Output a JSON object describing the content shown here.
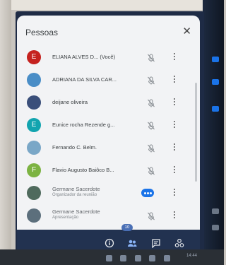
{
  "panel": {
    "title": "Pessoas",
    "close_icon": "close-icon"
  },
  "participants": [
    {
      "initial": "E",
      "avatar_color": "#c5221f",
      "name": "ELIANA ALVES D...  (Você)",
      "subtitle": "",
      "mic": "muted"
    },
    {
      "initial": "",
      "avatar_color": "#4a8ec7",
      "name": "ADRIANA DA SILVA CAR...",
      "subtitle": "",
      "mic": "muted"
    },
    {
      "initial": "",
      "avatar_color": "#3a4f7a",
      "name": "deijane oliveira",
      "subtitle": "",
      "mic": "muted"
    },
    {
      "initial": "E",
      "avatar_color": "#12a4af",
      "name": "Eunice rocha Rezende g...",
      "subtitle": "",
      "mic": "muted"
    },
    {
      "initial": "",
      "avatar_color": "#7aa7c7",
      "name": "Fernando C. Belm.",
      "subtitle": "",
      "mic": "muted"
    },
    {
      "initial": "F",
      "avatar_color": "#7cb342",
      "name": "Flavio Augusto Baiôco B...",
      "subtitle": "",
      "mic": "muted"
    },
    {
      "initial": "",
      "avatar_color": "#4f6a5d",
      "name": "Germane Sacerdote",
      "subtitle": "Organizador da reunião",
      "mic": "speaking"
    },
    {
      "initial": "",
      "avatar_color": "#5c6f7c",
      "name": "Germane Sacerdote",
      "subtitle": "Apresentação",
      "mic": "muted"
    }
  ],
  "bottom_bar": {
    "people_count": "10",
    "icons": [
      "info-icon",
      "people-icon",
      "chat-icon",
      "activities-icon"
    ]
  },
  "clock": "14:44"
}
